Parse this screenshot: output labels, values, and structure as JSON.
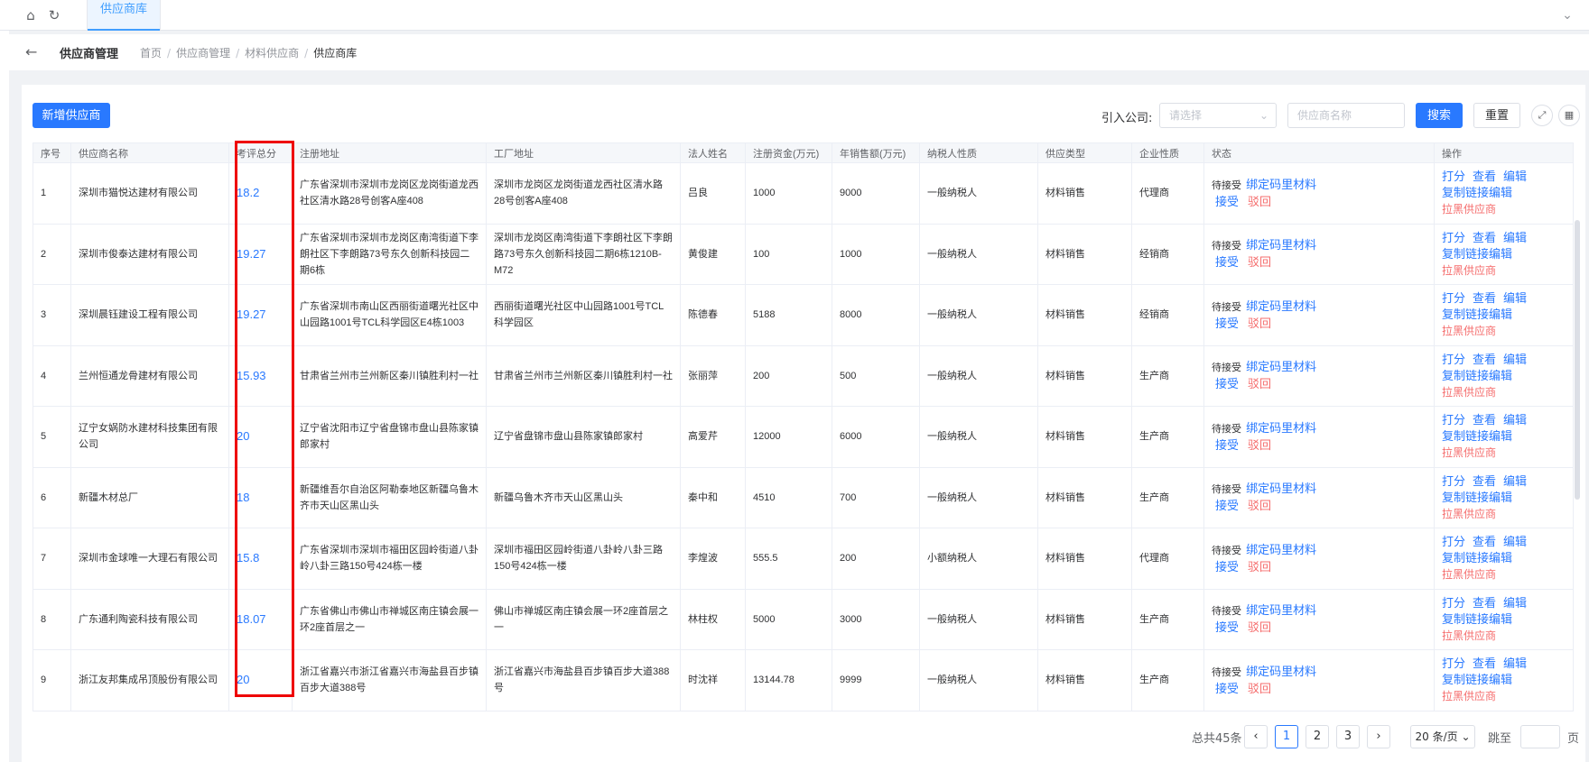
{
  "topbar": {
    "tab_label": "供应商库"
  },
  "header": {
    "title": "供应商管理",
    "breadcrumbs": [
      "首页",
      "供应商管理",
      "材料供应商",
      "供应商库"
    ]
  },
  "toolbar": {
    "add_label": "新增供应商",
    "company_label": "引入公司:",
    "company_placeholder": "请选择",
    "name_placeholder": "供应商名称",
    "search_label": "搜索",
    "reset_label": "重置"
  },
  "table": {
    "columns": [
      "序号",
      "供应商名称",
      "考评总分",
      "注册地址",
      "工厂地址",
      "法人姓名",
      "注册资金(万元)",
      "年销售额(万元)",
      "纳税人性质",
      "供应类型",
      "企业性质",
      "状态",
      "操作"
    ],
    "status_text": "待接受",
    "status_links": {
      "bind": "绑定码里材料",
      "accept": "接受",
      "reject": "驳回"
    },
    "actions": {
      "score": "打分",
      "view": "查看",
      "edit": "编辑",
      "copy_link": "复制链接编辑",
      "blacklist": "拉黑供应商"
    },
    "rows": [
      {
        "no": "1",
        "name": "深圳市猫悦达建材有限公司",
        "score": "18.2",
        "reg_addr": "广东省深圳市深圳市龙岗区龙岗街道龙西社区清水路28号创客A座408",
        "factory_addr": "深圳市龙岗区龙岗街道龙西社区清水路28号创客A座408",
        "legal": "吕良",
        "capital": "1000",
        "sales": "9000",
        "tax": "一般纳税人",
        "supply": "材料销售",
        "nature": "代理商"
      },
      {
        "no": "2",
        "name": "深圳市俊泰达建材有限公司",
        "score": "19.27",
        "reg_addr": "广东省深圳市深圳市龙岗区南湾街道下李朗社区下李朗路73号东久创新科技园二期6栋",
        "factory_addr": "深圳市龙岗区南湾街道下李朗社区下李朗路73号东久创新科技园二期6栋1210B-M72",
        "legal": "黄俊建",
        "capital": "100",
        "sales": "1000",
        "tax": "一般纳税人",
        "supply": "材料销售",
        "nature": "经销商"
      },
      {
        "no": "3",
        "name": "深圳晨钰建设工程有限公司",
        "score": "19.27",
        "reg_addr": "广东省深圳市南山区西丽街道曙光社区中山园路1001号TCL科学园区E4栋1003",
        "factory_addr": "西丽街道曙光社区中山园路1001号TCL科学园区",
        "legal": "陈德春",
        "capital": "5188",
        "sales": "8000",
        "tax": "一般纳税人",
        "supply": "材料销售",
        "nature": "经销商"
      },
      {
        "no": "4",
        "name": "兰州恒通龙骨建材有限公司",
        "score": "15.93",
        "reg_addr": "甘肃省兰州市兰州新区秦川镇胜利村一社",
        "factory_addr": "甘肃省兰州市兰州新区秦川镇胜利村一社",
        "legal": "张丽萍",
        "capital": "200",
        "sales": "500",
        "tax": "一般纳税人",
        "supply": "材料销售",
        "nature": "生产商"
      },
      {
        "no": "5",
        "name": "辽宁女娲防水建材科技集团有限公司",
        "score": "20",
        "reg_addr": "辽宁省沈阳市辽宁省盘锦市盘山县陈家镇郎家村",
        "factory_addr": "辽宁省盘锦市盘山县陈家镇郎家村",
        "legal": "高爱芹",
        "capital": "12000",
        "sales": "6000",
        "tax": "一般纳税人",
        "supply": "材料销售",
        "nature": "生产商"
      },
      {
        "no": "6",
        "name": "新疆木材总厂",
        "score": "18",
        "reg_addr": "新疆维吾尔自治区阿勒泰地区新疆乌鲁木齐市天山区黑山头",
        "factory_addr": "新疆乌鲁木齐市天山区黑山头",
        "legal": "秦中和",
        "capital": "4510",
        "sales": "700",
        "tax": "一般纳税人",
        "supply": "材料销售",
        "nature": "生产商"
      },
      {
        "no": "7",
        "name": "深圳市金球唯一大理石有限公司",
        "score": "15.8",
        "reg_addr": "广东省深圳市深圳市福田区园岭街道八卦岭八卦三路150号424栋一楼",
        "factory_addr": "深圳市福田区园岭街道八卦岭八卦三路150号424栋一楼",
        "legal": "李煌波",
        "capital": "555.5",
        "sales": "200",
        "tax": "小额纳税人",
        "supply": "材料销售",
        "nature": "代理商"
      },
      {
        "no": "8",
        "name": "广东通利陶瓷科技有限公司",
        "score": "18.07",
        "reg_addr": "广东省佛山市佛山市禅城区南庄镇会展一环2座首层之一",
        "factory_addr": "佛山市禅城区南庄镇会展一环2座首层之一",
        "legal": "林柱权",
        "capital": "5000",
        "sales": "3000",
        "tax": "一般纳税人",
        "supply": "材料销售",
        "nature": "生产商"
      },
      {
        "no": "9",
        "name": "浙江友邦集成吊顶股份有限公司",
        "score": "20",
        "reg_addr": "浙江省嘉兴市浙江省嘉兴市海盐县百步镇百步大道388号",
        "factory_addr": "浙江省嘉兴市海盐县百步镇百步大道388号",
        "legal": "时沈祥",
        "capital": "13144.78",
        "sales": "9999",
        "tax": "一般纳税人",
        "supply": "材料销售",
        "nature": "生产商"
      }
    ]
  },
  "pagination": {
    "total": "总共45条",
    "pages": [
      "1",
      "2",
      "3"
    ],
    "page_size": "20 条/页",
    "goto_label": "跳至",
    "page_suffix": "页"
  }
}
